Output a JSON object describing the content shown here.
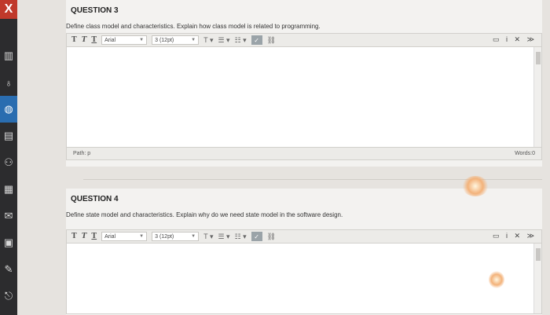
{
  "sidebar": {
    "close_label": "X",
    "icons": [
      "bank-icon",
      "users-icon",
      "globe-icon",
      "calendar-icon",
      "group-icon",
      "grid-icon",
      "mail-icon",
      "document-icon",
      "edit-icon",
      "logout-icon"
    ]
  },
  "questions": [
    {
      "title": "QUESTION 3",
      "text": "Define class model and characteristics.  Explain how class model is related to programming.",
      "toolbar": {
        "font": "Arial",
        "size": "3 (12pt)"
      },
      "path_label": "Path: p",
      "words_label": "Words:0"
    },
    {
      "title": "QUESTION 4",
      "text": "Define state model and characteristics. Explain why do we need state model in the software design.",
      "toolbar": {
        "font": "Arial",
        "size": "3 (12pt)"
      }
    }
  ],
  "colors": {
    "sidebar_bg": "#2c2c2e",
    "close_bg": "#c0392b",
    "active_bg": "#2a6db0"
  }
}
